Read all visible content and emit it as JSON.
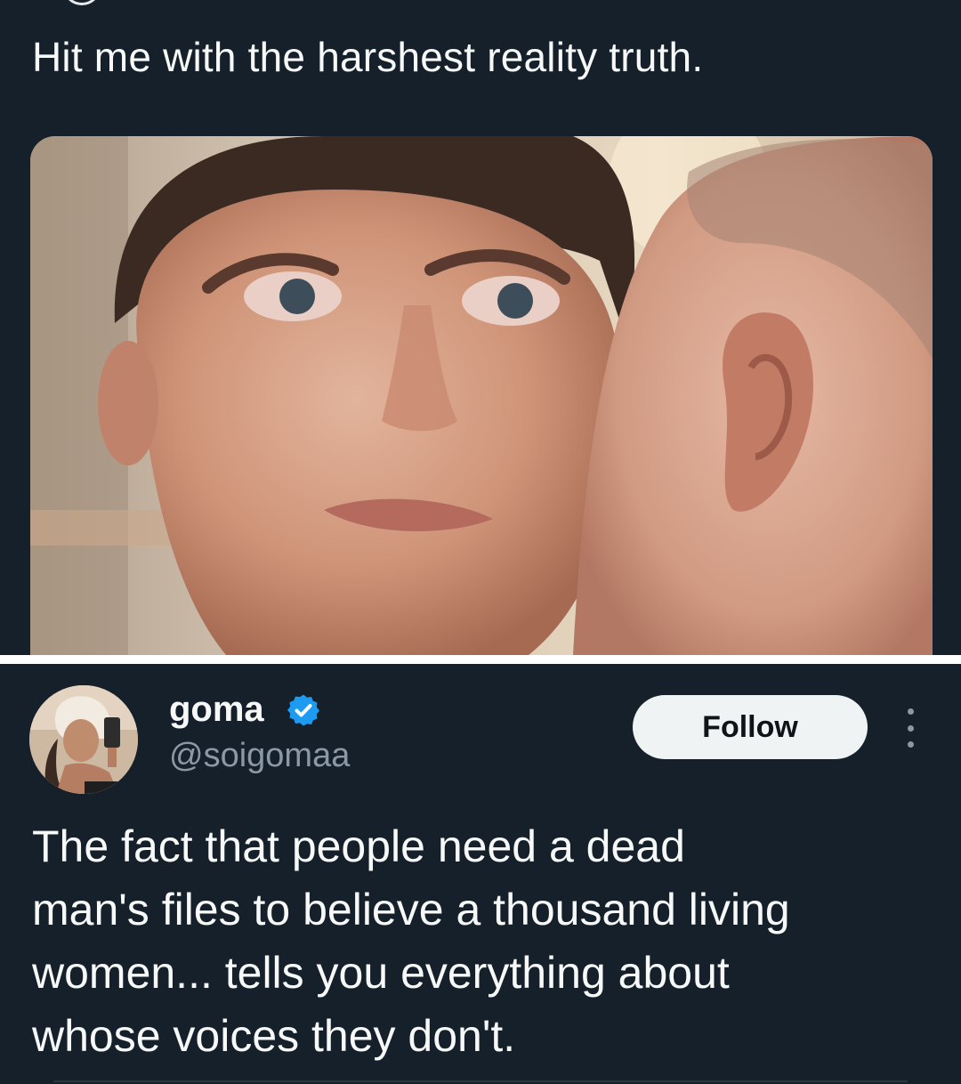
{
  "quoted_tweet": {
    "text": "Hit me with the harshest reality truth.",
    "media_alt": ""
  },
  "reply": {
    "display_name": "goma",
    "handle": "@soigomaa",
    "follow_label": "Follow",
    "body_lines": [
      "The fact that people need a dead",
      "man's files to believe a thousand living",
      "women... tells you everything about",
      "whose voices they don't."
    ]
  },
  "colors": {
    "background": "#15202b",
    "text": "#f7f9f9",
    "secondary_text": "#8b98a5",
    "verified": "#1d9bf0",
    "follow_bg": "#eff3f4"
  },
  "icons": {
    "verified": "verified-badge-icon",
    "more": "more-options-icon"
  }
}
